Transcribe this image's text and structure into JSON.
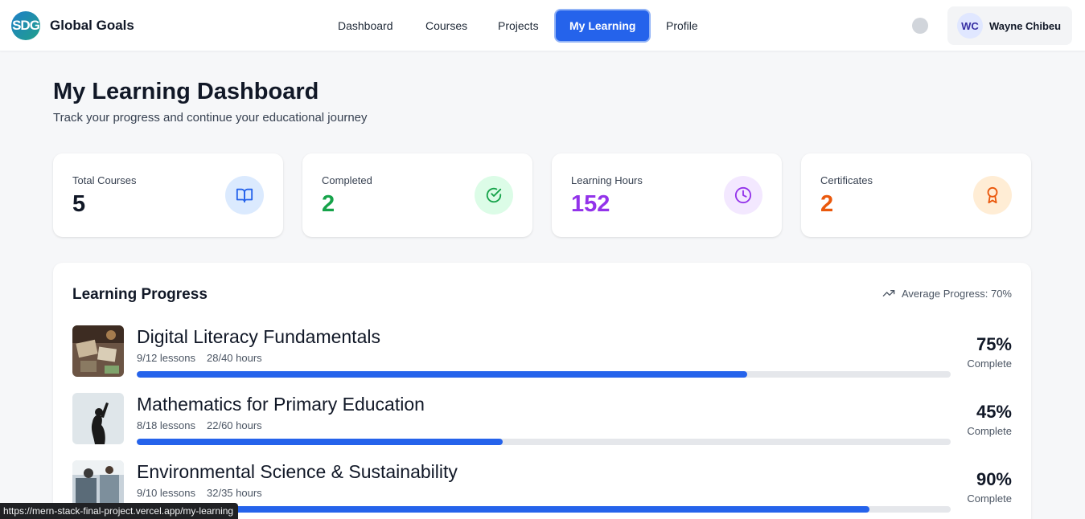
{
  "brand": {
    "logo_text": "SDG",
    "name": "Global Goals"
  },
  "nav": {
    "items": [
      {
        "label": "Dashboard",
        "active": false
      },
      {
        "label": "Courses",
        "active": false
      },
      {
        "label": "Projects",
        "active": false
      },
      {
        "label": "My Learning",
        "active": true
      },
      {
        "label": "Profile",
        "active": false
      }
    ]
  },
  "user": {
    "initials": "WC",
    "name": "Wayne Chibeu"
  },
  "page": {
    "title": "My Learning Dashboard",
    "subtitle": "Track your progress and continue your educational journey"
  },
  "stats": [
    {
      "label": "Total Courses",
      "value": "5",
      "color": "#111827",
      "icon": "book-icon",
      "icon_bg": "#dbeafe",
      "icon_color": "#2563eb"
    },
    {
      "label": "Completed",
      "value": "2",
      "color": "#16a34a",
      "icon": "check-circle-icon",
      "icon_bg": "#dcfce7",
      "icon_color": "#16a34a"
    },
    {
      "label": "Learning Hours",
      "value": "152",
      "color": "#9333ea",
      "icon": "clock-icon",
      "icon_bg": "#f3e8ff",
      "icon_color": "#9333ea"
    },
    {
      "label": "Certificates",
      "value": "2",
      "color": "#ea580c",
      "icon": "award-icon",
      "icon_bg": "#ffedd5",
      "icon_color": "#ea580c"
    }
  ],
  "progress": {
    "title": "Learning Progress",
    "average_label": "Average Progress: 70%",
    "courses": [
      {
        "name": "Digital Literacy Fundamentals",
        "lessons": "9/12 lessons",
        "hours": "28/40 hours",
        "percent": 75,
        "percent_label": "75%",
        "complete_label": "Complete",
        "thumb": "desk-photo"
      },
      {
        "name": "Mathematics for Primary Education",
        "lessons": "8/18 lessons",
        "hours": "22/60 hours",
        "percent": 45,
        "percent_label": "45%",
        "complete_label": "Complete",
        "thumb": "chalkboard-photo"
      },
      {
        "name": "Environmental Science & Sustainability",
        "lessons": "9/10 lessons",
        "hours": "32/35 hours",
        "percent": 90,
        "percent_label": "90%",
        "complete_label": "Complete",
        "thumb": "classroom-photo"
      }
    ]
  },
  "status_bar": {
    "url": "https://mern-stack-final-project.vercel.app/my-learning"
  },
  "colors": {
    "accent": "#2563eb",
    "track": "#e5e7eb"
  }
}
